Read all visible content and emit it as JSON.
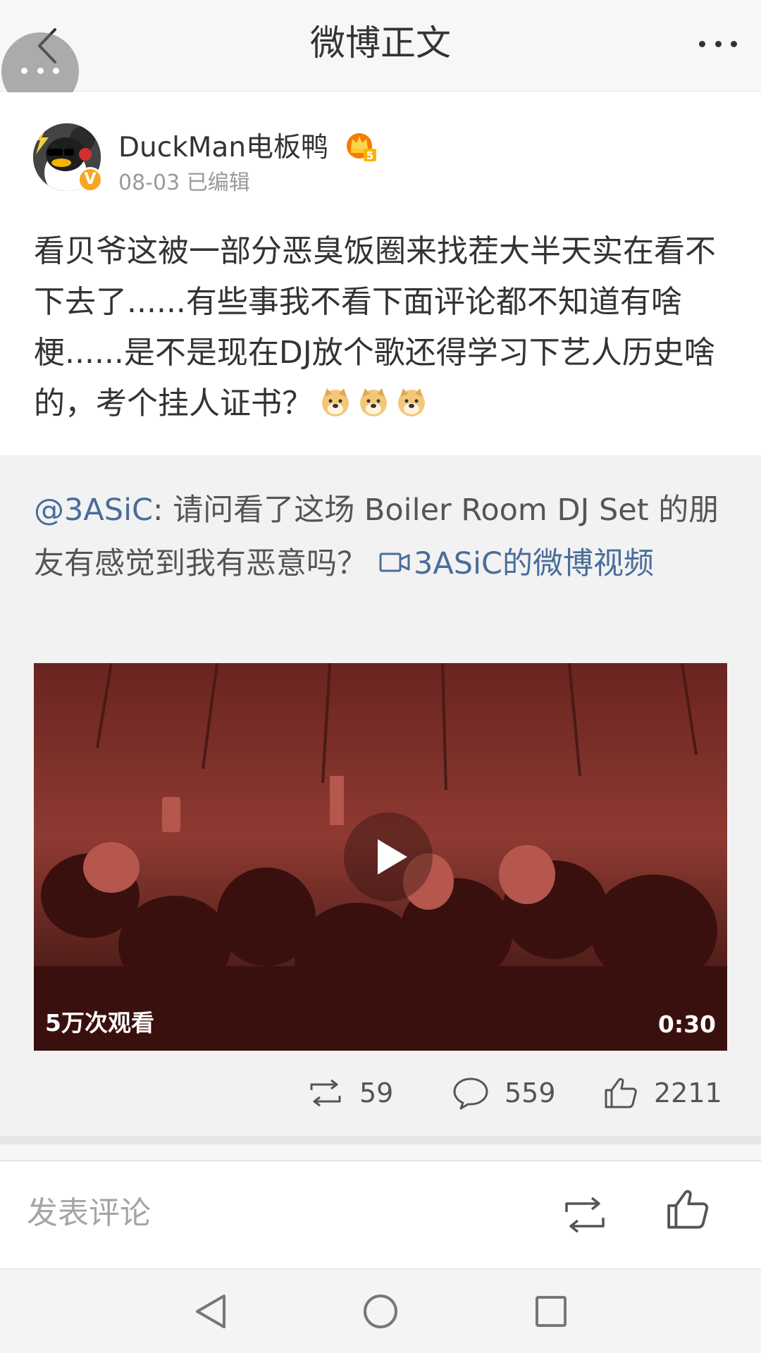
{
  "header": {
    "title": "微博正文",
    "back_icon": "chevron-left-icon",
    "more_icon": "more-horizontal-icon",
    "floating_icon": "floating-menu-icon"
  },
  "post": {
    "username": "DuckMan电板鸭",
    "meta": "08-03 已编辑",
    "verified_badge": "V",
    "member_level": "5",
    "text": "看贝爷这被一部分恶臭饭圈来找茬大半天实在看不下去了......有些事我不看下面评论都不知道有啥梗......是不是现在DJ放个歌还得学习下艺人历史啥的，考个挂人证书？",
    "emoji_icon": "doge-emoji-icon",
    "emoji_count": 3
  },
  "repost": {
    "mention": "@3ASiC",
    "text": ": 请问看了这场 Boiler Room DJ Set 的朋友有感觉到我有恶意吗？",
    "video_link": "3ASiC的微博视频",
    "video": {
      "views": "5万次观看",
      "duration": "0:30"
    },
    "actions": {
      "repost_count": "59",
      "comment_count": "559",
      "like_count": "2211"
    }
  },
  "comment_bar": {
    "placeholder": "发表评论"
  },
  "colors": {
    "link": "#4a6d9a",
    "repost_bg": "#f2f2f2",
    "badge": "#f6a623"
  }
}
